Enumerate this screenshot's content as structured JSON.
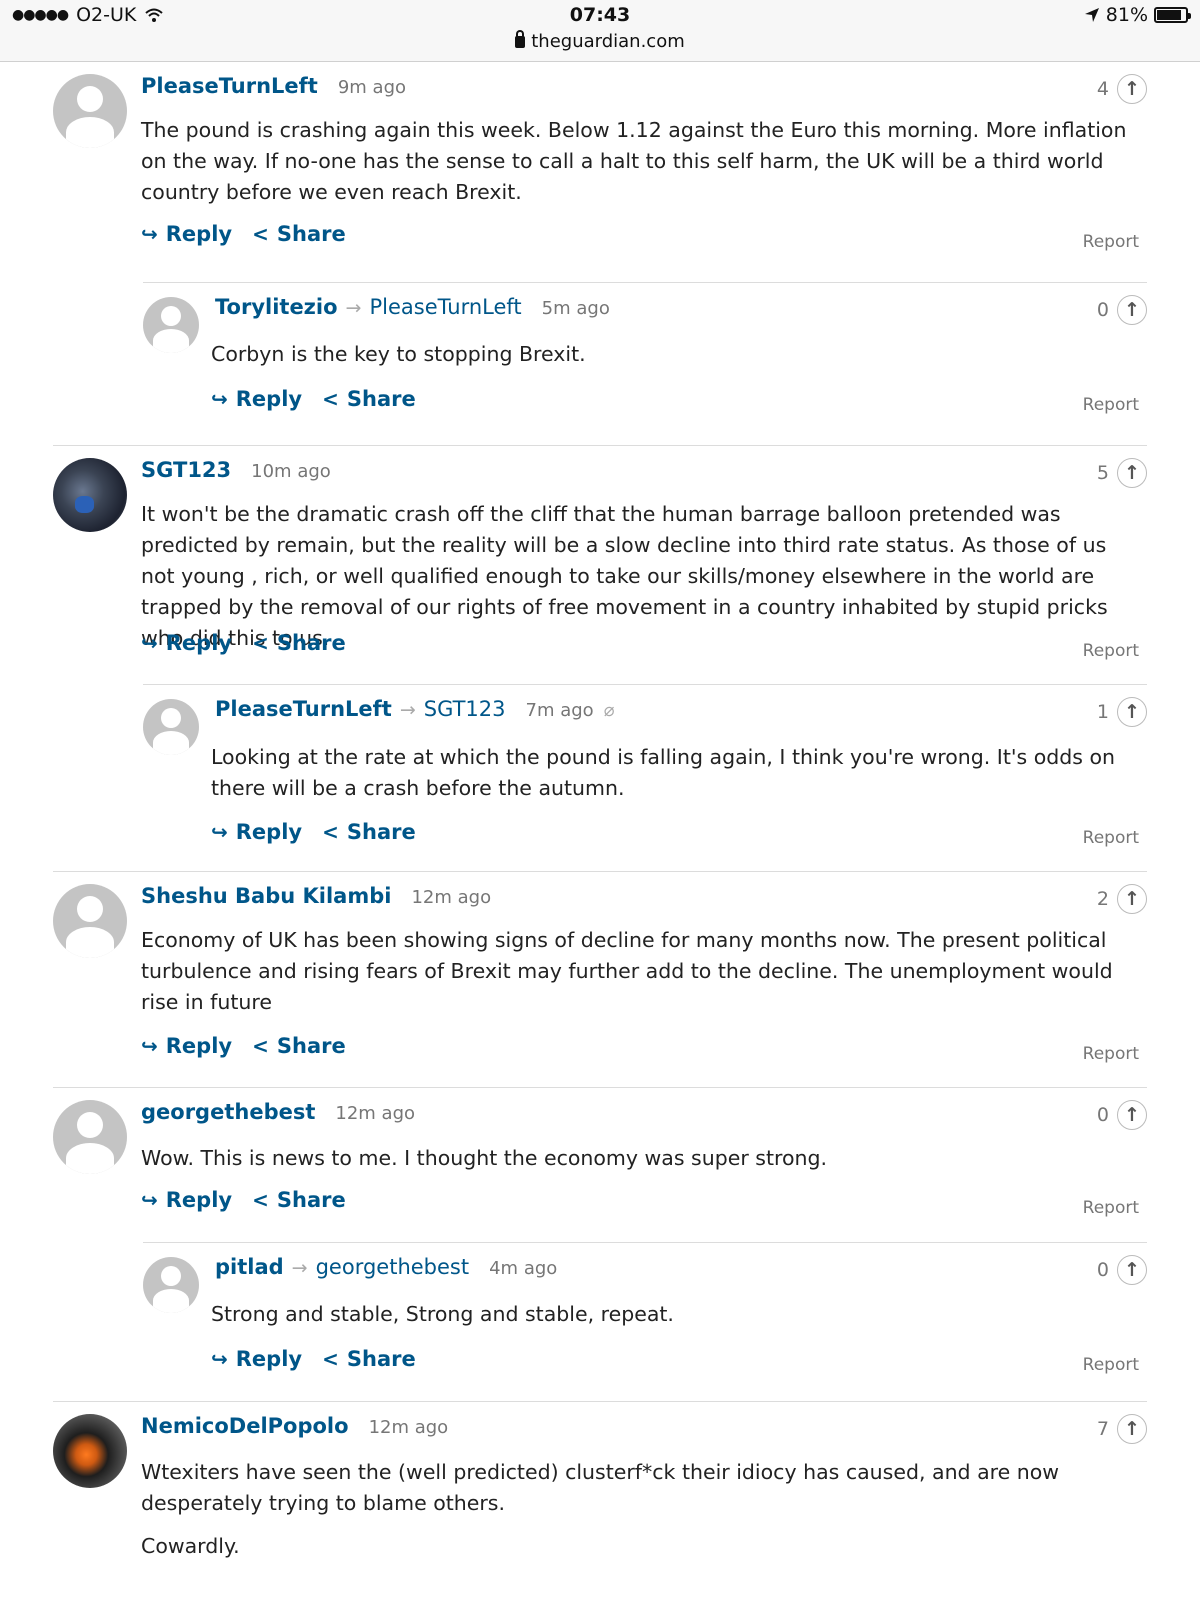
{
  "status_bar": {
    "carrier": "O2-UK",
    "time": "07:43",
    "url": "theguardian.com",
    "battery": "81%"
  },
  "labels": {
    "reply": "Reply",
    "share": "Share",
    "report": "Report"
  },
  "comments": [
    {
      "author": "PleaseTurnLeft",
      "time": "9m ago",
      "votes": "4",
      "text": [
        "The pound is crashing again this week. Below 1.12 against the Euro this morning. More inflation on the way. If no-one has the sense to call a halt to this self harm, the UK will be a third world country before we even reach Brexit."
      ]
    },
    {
      "author": "Torylitezio",
      "reply_to": "PleaseTurnLeft",
      "time": "5m ago",
      "votes": "0",
      "text": [
        "Corbyn is the key to stopping Brexit."
      ]
    },
    {
      "author": "SGT123",
      "time": "10m ago",
      "votes": "5",
      "text": [
        "It won't be the dramatic crash off the cliff that the human barrage balloon pretended was predicted by remain, but the reality will be a slow decline into third rate status. As those of us not young , rich, or well qualified enough to take our skills/money elsewhere in the world are trapped by the removal of our rights of free movement in a country inhabited by stupid pricks who did this to us."
      ]
    },
    {
      "author": "PleaseTurnLeft",
      "reply_to": "SGT123",
      "time": "7m ago",
      "votes": "1",
      "text": [
        "Looking at the rate at which the pound is falling again, I think you're wrong. It's odds on there will be a crash before the autumn."
      ]
    },
    {
      "author": "Sheshu Babu Kilambi",
      "time": "12m ago",
      "votes": "2",
      "text": [
        "Economy of UK has been showing signs of decline for many months now. The present political turbulence and rising fears of Brexit may further add to the decline. The unemployment would rise in future"
      ]
    },
    {
      "author": "georgethebest",
      "time": "12m ago",
      "votes": "0",
      "text": [
        "Wow. This is news to me. I thought the economy was super strong."
      ]
    },
    {
      "author": "pitlad",
      "reply_to": "georgethebest",
      "time": "4m ago",
      "votes": "0",
      "text": [
        "Strong and stable, Strong and stable, repeat."
      ]
    },
    {
      "author": "NemicoDelPopolo",
      "time": "12m ago",
      "votes": "7",
      "text": [
        "Wtexiters have seen the (well predicted) clusterf*ck their idiocy has caused, and are now desperately trying to blame others.",
        "Cowardly."
      ]
    }
  ]
}
